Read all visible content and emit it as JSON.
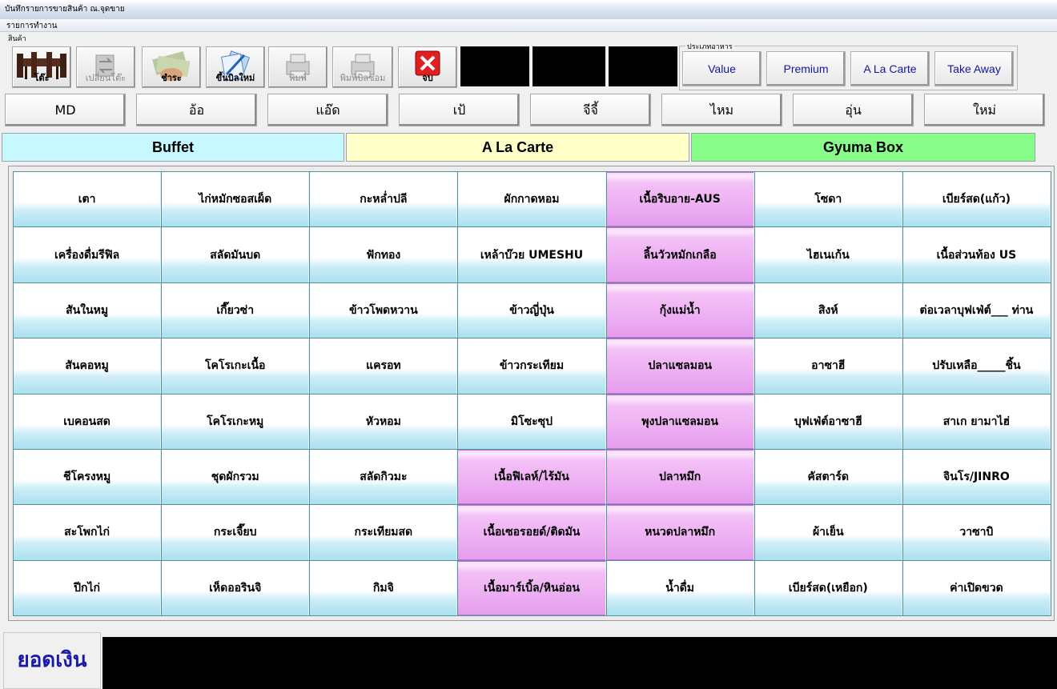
{
  "window": {
    "title": "บันทึกรายการขายสินค้า ณ.จุดขาย"
  },
  "menu": {
    "label": "รายการทำงาน"
  },
  "toolbar": {
    "group_label": "สินค้า",
    "buttons": [
      {
        "label": "โต๊ะ",
        "icon": "table-icon",
        "enabled": true
      },
      {
        "label": "เปลี่ยนโต๊ะ",
        "icon": "swap-table-icon",
        "enabled": false
      },
      {
        "label": "ชำระ",
        "icon": "money-icon",
        "enabled": true
      },
      {
        "label": "ขึ้นบิลใหม่",
        "icon": "new-bill-icon",
        "enabled": true
      },
      {
        "label": "พิมพ์",
        "icon": "printer-icon",
        "enabled": false
      },
      {
        "label": "พิมพ์บิลซ่อม",
        "icon": "printer-repair-icon",
        "enabled": false
      },
      {
        "label": "จบ",
        "icon": "close-x-icon",
        "enabled": true
      }
    ]
  },
  "food_type": {
    "group_label": "ประเภทอาหาร",
    "options": [
      "Value",
      "Premium",
      "A La Carte",
      "Take Away"
    ]
  },
  "staff": [
    "MD",
    "อ้อ",
    "แอ๊ด",
    "เป้",
    "จีจี้",
    "ไหม",
    "อุ่น",
    "ใหม่"
  ],
  "categories": [
    {
      "label": "Buffet",
      "color": "#c6f8ff"
    },
    {
      "label": "A La Carte",
      "color": "#ffffc8"
    },
    {
      "label": "Gyuma Box",
      "color": "#88fc88"
    }
  ],
  "products": [
    [
      "เตา",
      "ไก่หมักซอสเผ็ด",
      "กะหล่ำปลี",
      "ผักกาดหอม",
      "เนื้อริบอาย-AUS",
      "โซดา",
      "เบียร์สด(แก้ว)"
    ],
    [
      "เครื่องดื่มรีฟิล",
      "สลัดมันบด",
      "ฟักทอง",
      "เหล้าบ๊วย UMESHU",
      "ลิ้นวัวหมักเกลือ",
      "ไฮเนเก้น",
      "เนื้อส่วนท้อง US"
    ],
    [
      "สันในหมู",
      "เกี๊ยวซ่า",
      "ข้าวโพดหวาน",
      "ข้าวญี่ปุ่น",
      "กุ้งแม่น้ำ",
      "สิงห์",
      "ต่อเวลาบุฟเฟ่ต์___ ท่าน"
    ],
    [
      "สันคอหมู",
      "โคโรเกะเนื้อ",
      "แครอท",
      "ข้าวกระเทียม",
      "ปลาแซลมอน",
      "อาซาฮี",
      "ปรับเหลือ_____ชิ้น"
    ],
    [
      "เบคอนสด",
      "โคโรเกะหมู",
      "หัวหอม",
      "มิโซะซุป",
      "พุงปลาแซลมอน",
      "บุฟเฟ่ต์อาซาฮี",
      "สาเก ยามาไฮ่"
    ],
    [
      "ชีโครงหมู",
      "ชุดผักรวม",
      "สลัดกิวมะ",
      "เนื้อฟิเลห์/ไร้มัน",
      "ปลาหมึก",
      "คัสตาร์ด",
      "จินโร/JINRO"
    ],
    [
      "สะโพกไก่",
      "กระเจี๊ยบ",
      "กระเทียมสด",
      "เนื้อเซอรอยด์/ติดมัน",
      "หนวดปลาหมึก",
      "ผ้าเย็น",
      "วาซาบิ"
    ],
    [
      "ปีกไก่",
      "เห็ดออรินจิ",
      "กิมจิ",
      "เนื้อมาร์เบิ้ล/หินอ่อน",
      "น้ำดื่ม",
      "เบียร์สด(เหยือก)",
      "ค่าเปิดขวด"
    ]
  ],
  "highlighted": [
    [
      0,
      4
    ],
    [
      1,
      4
    ],
    [
      2,
      4
    ],
    [
      3,
      4
    ],
    [
      4,
      4
    ],
    [
      5,
      3
    ],
    [
      5,
      4
    ],
    [
      6,
      3
    ],
    [
      6,
      4
    ],
    [
      7,
      3
    ]
  ],
  "footer": {
    "total_label": "ยอดเงิน",
    "total_value": ""
  }
}
